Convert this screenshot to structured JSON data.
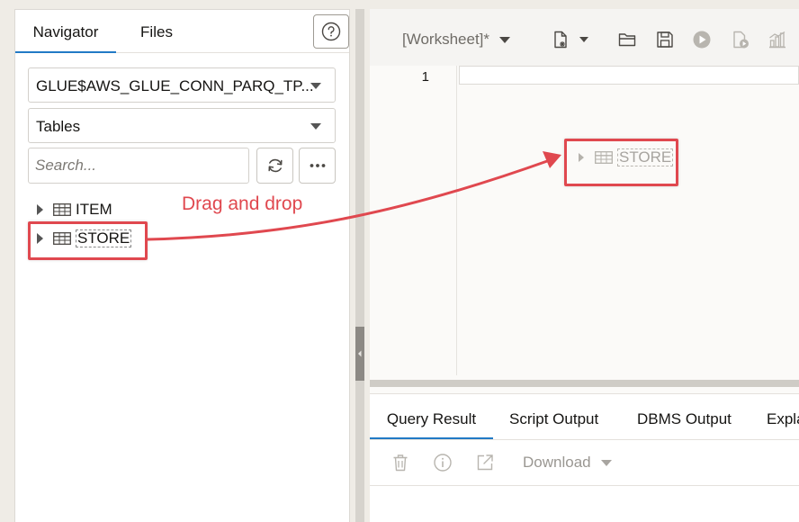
{
  "navigator": {
    "tabs": [
      {
        "label": "Navigator",
        "active": true
      },
      {
        "label": "Files",
        "active": false
      }
    ],
    "help_icon": "help-circle-icon",
    "connection_select": {
      "value": "GLUE$AWS_GLUE_CONN_PARQ_TP..."
    },
    "object_type_select": {
      "value": "Tables"
    },
    "search": {
      "placeholder": "Search...",
      "value": ""
    },
    "refresh_icon": "refresh-icon",
    "more_icon": "more-horizontal-icon",
    "tree": [
      {
        "label": "ITEM",
        "icon": "table-icon"
      },
      {
        "label": "STORE",
        "icon": "table-icon",
        "dragging": true
      }
    ]
  },
  "annotation": {
    "text": "Drag and drop",
    "color": "#e0484f"
  },
  "worksheet": {
    "title": "[Worksheet]*",
    "toolbar_icons": [
      "new-worksheet-icon",
      "open-folder-icon",
      "save-icon",
      "run-icon",
      "run-script-icon",
      "explain-plan-icon"
    ],
    "line_number": "1",
    "drag_ghost": {
      "label": "STORE",
      "icon": "table-icon"
    }
  },
  "results": {
    "tabs": [
      {
        "label": "Query Result",
        "active": true
      },
      {
        "label": "Script Output",
        "active": false
      },
      {
        "label": "DBMS Output",
        "active": false
      },
      {
        "label": "Expla",
        "active": false
      }
    ],
    "toolbar_icons": [
      "trash-icon",
      "info-icon",
      "open-external-icon"
    ],
    "download_label": "Download"
  },
  "colors": {
    "accent": "#227ac5",
    "highlight": "#e0484f",
    "background": "#efece6"
  }
}
